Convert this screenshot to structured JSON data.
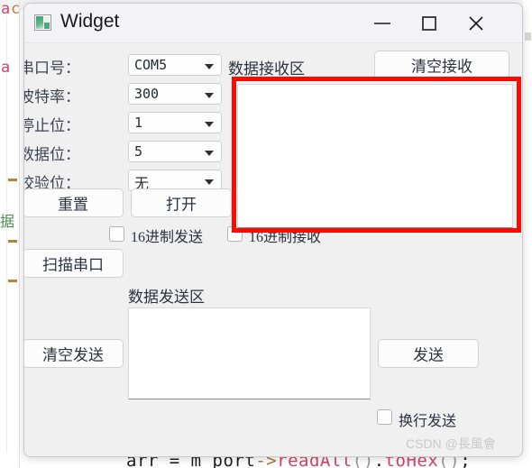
{
  "window": {
    "title": "Widget",
    "icon": "app-image-icon",
    "controls": {
      "minimize": "minimize-icon",
      "maximize": "maximize-icon",
      "close": "close-icon"
    }
  },
  "form": {
    "rows": [
      {
        "label": "串口号：",
        "value": "COM5",
        "cjk": false
      },
      {
        "label": "波特率：",
        "value": "300",
        "cjk": false
      },
      {
        "label": "停止位：",
        "value": "1",
        "cjk": false
      },
      {
        "label": "数据位：",
        "value": "5",
        "cjk": false
      },
      {
        "label": "校验位：",
        "value": "无",
        "cjk": true
      }
    ],
    "buttons": {
      "reset": "重置",
      "open": "打开",
      "scan": "扫描串口",
      "clear_send": "清空发送",
      "clear_recv": "清空接收",
      "send": "发送"
    },
    "checkboxes": {
      "hex_send": "16进制发送",
      "hex_recv": "16进制接收",
      "newline_send": "换行发送"
    }
  },
  "panels": {
    "recv_label": "数据接收区",
    "recv_value": "",
    "send_label": "数据发送区",
    "send_value": ""
  },
  "annotation": {
    "highlight_color": "#fb0c00"
  },
  "background": {
    "code_line": "arr = m_port->readAll().toHex();",
    "code_tokens": [
      {
        "text": "arr = m_port",
        "style": "c-plain"
      },
      {
        "text": "->",
        "style": "c-arrow"
      },
      {
        "text": "readAll",
        "style": "c-call"
      },
      {
        "text": "()",
        "style": "c-paren"
      },
      {
        "text": ".",
        "style": "c-plain"
      },
      {
        "text": "toHex",
        "style": "c-call"
      },
      {
        "text": "()",
        "style": "c-paren"
      },
      {
        "text": ";",
        "style": "c-plain"
      }
    ],
    "left_fragments": [
      {
        "text": "a",
        "style": "c-red"
      },
      {
        "text": "c",
        "style": "c-orange"
      },
      {
        "text": "a",
        "style": "c-red"
      },
      {
        "text": "据",
        "style": "c-green"
      }
    ]
  },
  "watermark": {
    "prefix": "CSDN @",
    "name": "長風會"
  }
}
